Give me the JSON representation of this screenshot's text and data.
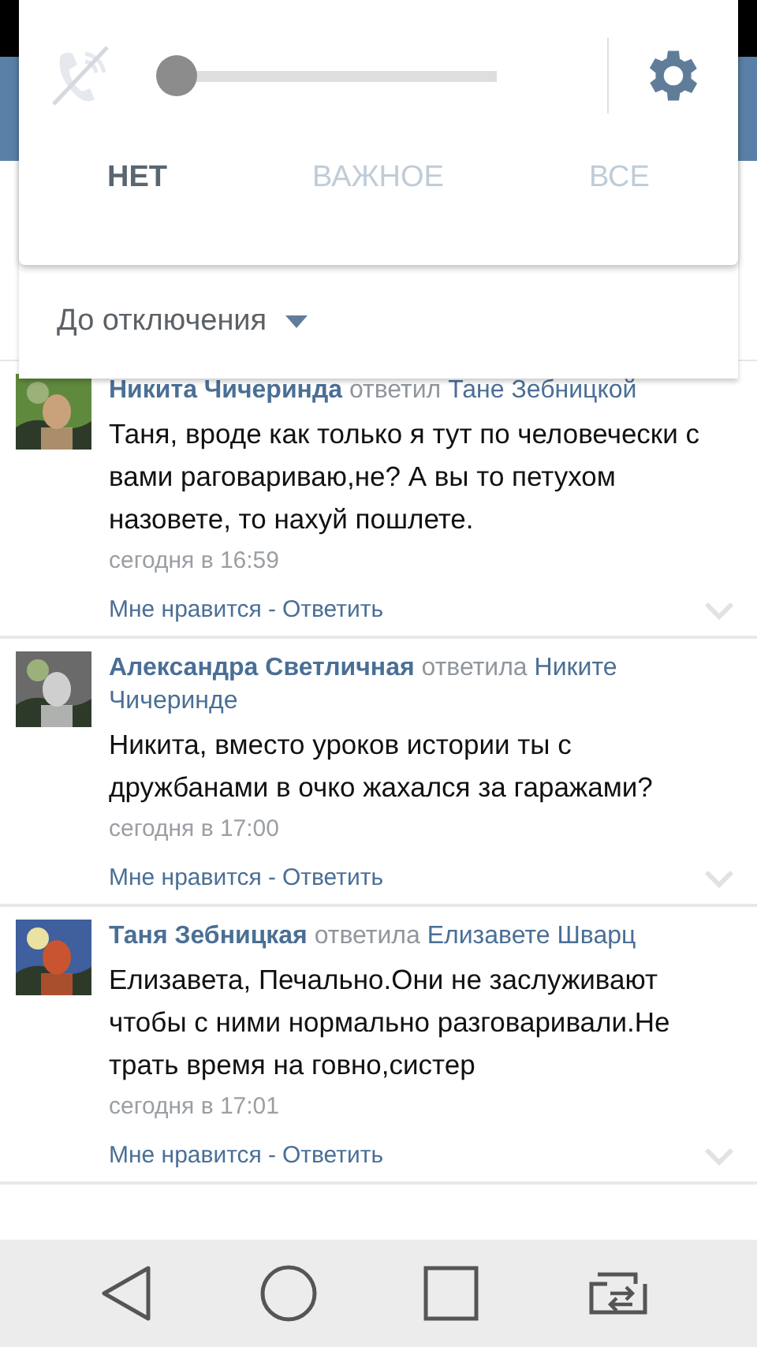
{
  "dnd_panel": {
    "slider": {
      "level": 0
    },
    "tabs": [
      {
        "label": "НЕТ",
        "selected": true
      },
      {
        "label": "ВАЖНОЕ",
        "selected": false
      },
      {
        "label": "ВСЕ",
        "selected": false
      }
    ],
    "duration": "До отключения"
  },
  "comments": [
    {
      "author": "Никита Чичеринда",
      "action": "ответил",
      "recipient": "Тане Зебницкой",
      "text": "Таня, вроде как только я тут по человечески с вами раговариваю,не? А вы то петухом назовете, то нахуй пошлете.",
      "time": "сегодня в 16:59",
      "like": "Мне нравится",
      "separator": "-",
      "reply": "Ответить"
    },
    {
      "author": "Александра Светличная",
      "action": "ответила",
      "recipient": "Никите Чичеринде",
      "text": "Никита, вместо уроков истории ты с дружбанами в очко жахался за гаражами?",
      "time": "сегодня в 17:00",
      "like": "Мне нравится",
      "separator": "-",
      "reply": "Ответить"
    },
    {
      "author": "Таня Зебницкая",
      "action": "ответила",
      "recipient": "Елизавете Шварц",
      "text": "Елизавета, Печально.Они не заслуживают чтобы с ними нормально разговаривали.Не трать время на говно,систер",
      "time": "сегодня в 17:01",
      "like": "Мне нравится",
      "separator": "-",
      "reply": "Ответить"
    }
  ]
}
